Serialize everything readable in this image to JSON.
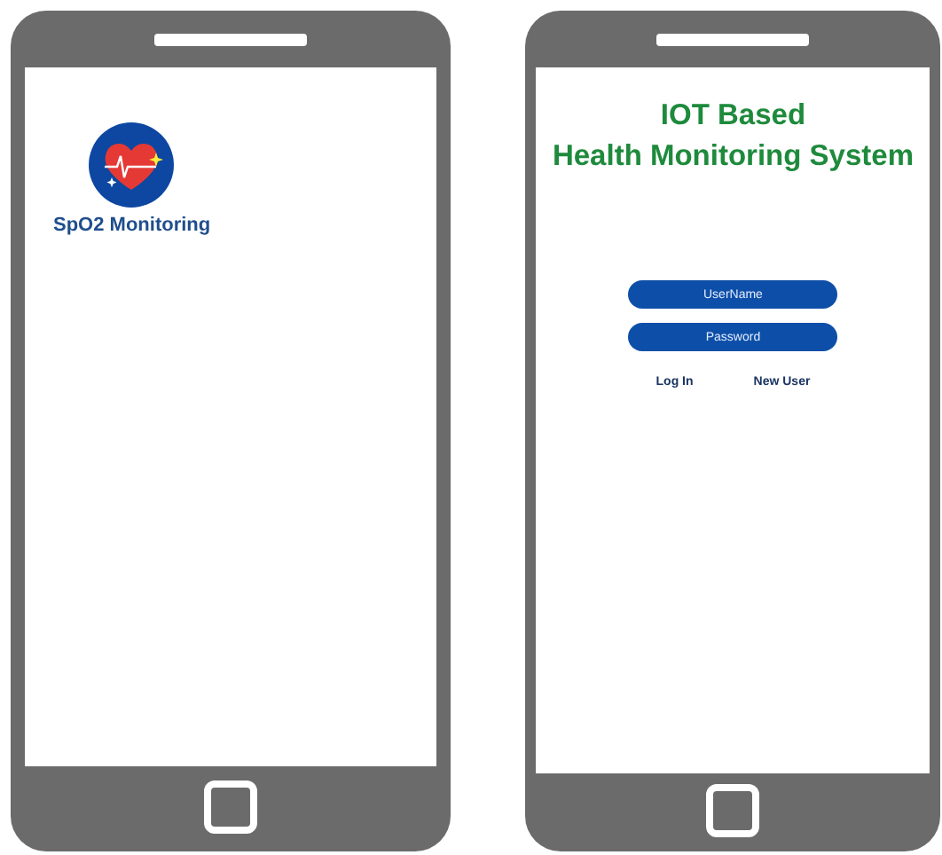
{
  "phones": [
    {
      "kind": "home",
      "apps": [
        {
          "label": "SpO2 Monitoring"
        }
      ]
    },
    {
      "kind": "login",
      "title": [
        "IOT Based",
        "Health Monitoring System"
      ],
      "fields": [
        {
          "placeholder": "UserName"
        },
        {
          "placeholder": "Password"
        }
      ],
      "links": [
        "Log In",
        "New User"
      ]
    }
  ]
}
